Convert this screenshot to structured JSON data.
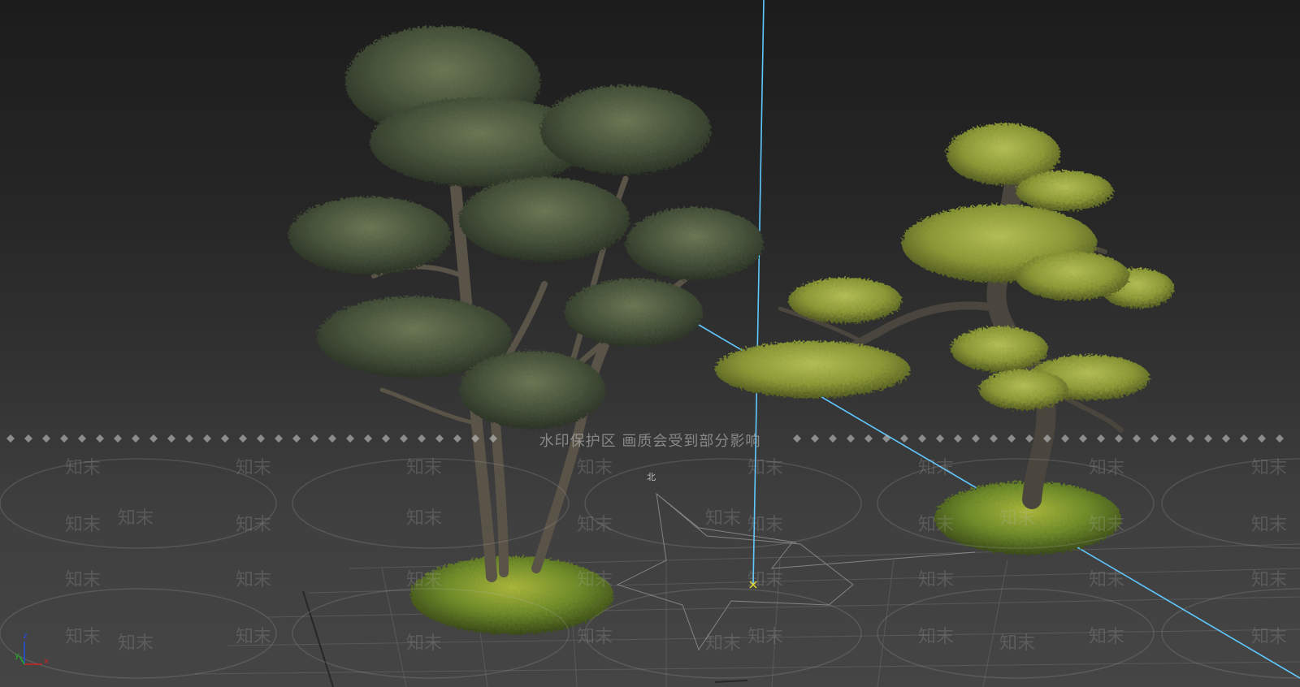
{
  "viewport": {
    "name": "3ds Max perspective viewport",
    "background_top": "#1c1c1c",
    "background_bottom": "#454545",
    "grid_color": "#6a6a6a"
  },
  "watermark": {
    "banner_text": "水印保护区   画质会受到部分影响",
    "tile_text": "知末"
  },
  "compass": {
    "north_label": "北"
  },
  "axis_tripod": {
    "x_label": "x",
    "y_label": "y",
    "z_label": "z",
    "x_color": "#d22020",
    "y_color": "#20b020",
    "z_color": "#2050e0"
  },
  "objects": [
    {
      "name": "broadleaf-bonsai-tree",
      "foliage_color": "#4d5a3a",
      "trunk_color": "#5a5348",
      "base_color": "#6d8a2a"
    },
    {
      "name": "pine-bonsai-tree",
      "foliage_color": "#8a9a3a",
      "trunk_color": "#4a463e",
      "base_color": "#7d9630"
    }
  ],
  "light": {
    "target_line_color": "#5fc8ff",
    "target_marker_color": "#e8e030"
  }
}
